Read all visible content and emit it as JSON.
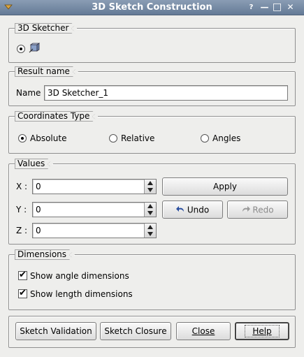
{
  "window": {
    "title": "3D Sketch Construction",
    "help_glyph": "?",
    "minimize_glyph": "—",
    "maximize_glyph": "□",
    "close_glyph": "✕"
  },
  "sketcher_group": {
    "label": "3D Sketcher"
  },
  "result_group": {
    "label": "Result name",
    "name_label": "Name",
    "name_value": "3D Sketcher_1"
  },
  "coords_group": {
    "label": "Coordinates Type",
    "options": [
      "Absolute",
      "Relative",
      "Angles"
    ],
    "selected": "Absolute"
  },
  "values_group": {
    "label": "Values",
    "x_label": "X :",
    "x_value": "0",
    "y_label": "Y :",
    "y_value": "0",
    "z_label": "Z :",
    "z_value": "0",
    "apply_label": "Apply",
    "undo_label": "Undo",
    "redo_label": "Redo"
  },
  "dimensions_group": {
    "label": "Dimensions",
    "angle_label": "Show angle dimensions",
    "angle_checked": true,
    "length_label": "Show length dimensions",
    "length_checked": true
  },
  "buttons": {
    "validation_label": "Sketch Validation",
    "closure_label": "Sketch Closure",
    "close_label": "Close",
    "help_label": "Help"
  },
  "colors": {
    "titlebar": "#647a96",
    "background": "#eeeeec",
    "undo_arrow": "#2a4fa0"
  }
}
